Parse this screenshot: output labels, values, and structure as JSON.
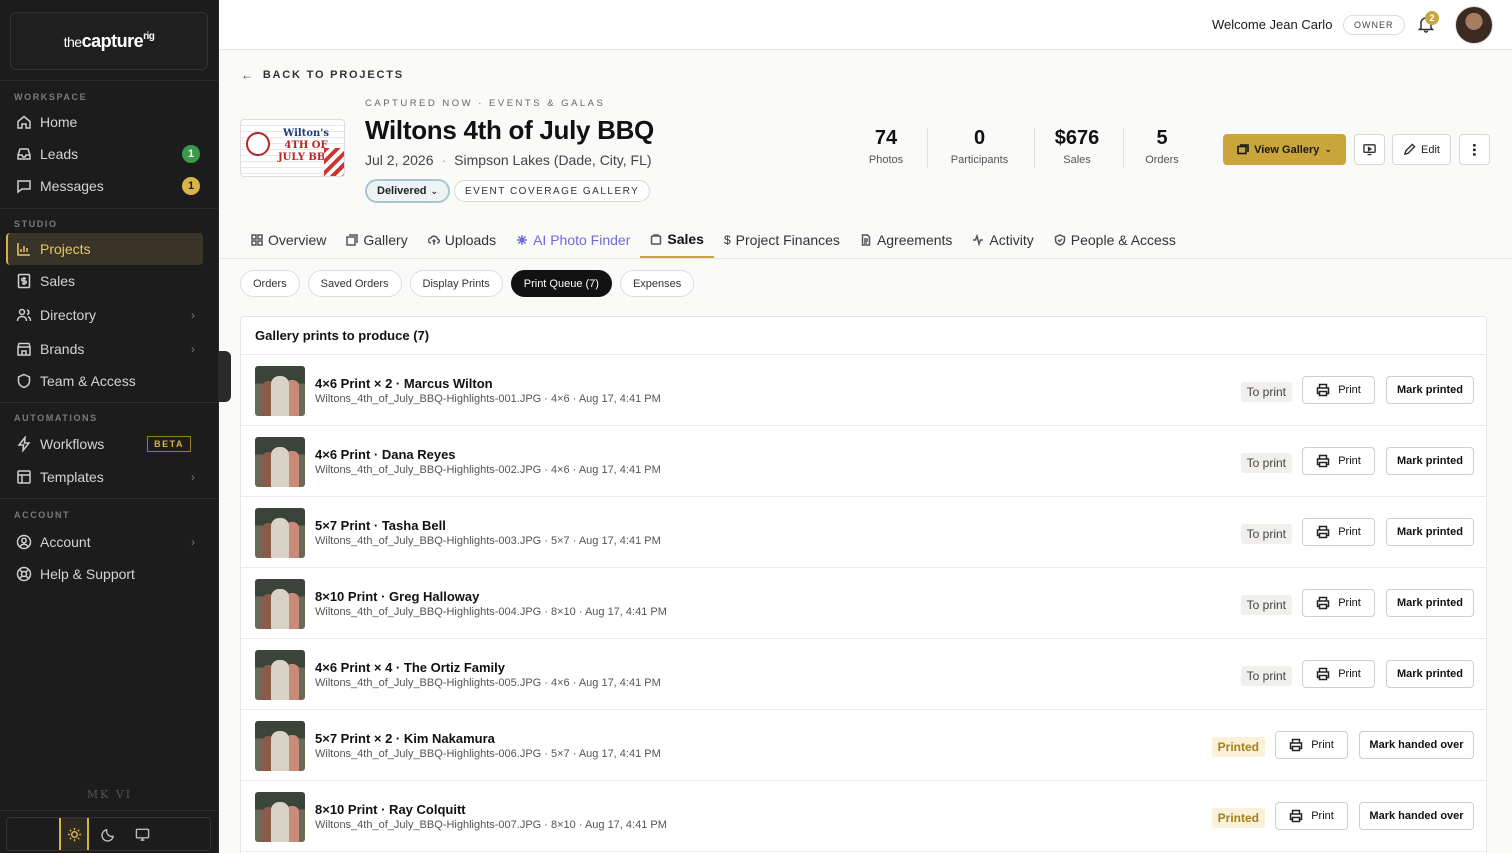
{
  "brand": {
    "name_a": "the",
    "name_b": "capture",
    "name_c": "rig"
  },
  "sidebar": {
    "sections": {
      "workspace": "WORKSPACE",
      "studio": "STUDIO",
      "automations": "AUTOMATIONS",
      "account": "ACCOUNT"
    },
    "items": {
      "home": {
        "label": "Home"
      },
      "leads": {
        "label": "Leads",
        "badge": "1"
      },
      "messages": {
        "label": "Messages",
        "badge": "1"
      },
      "projects": {
        "label": "Projects"
      },
      "sales": {
        "label": "Sales"
      },
      "directory": {
        "label": "Directory"
      },
      "brands": {
        "label": "Brands"
      },
      "team": {
        "label": "Team & Access"
      },
      "workflows": {
        "label": "Workflows",
        "tag": "BETA"
      },
      "templates": {
        "label": "Templates"
      },
      "account": {
        "label": "Account"
      },
      "help": {
        "label": "Help & Support"
      }
    },
    "footer_mark": "MK VI"
  },
  "topbar": {
    "welcome": "Welcome Jean Carlo",
    "role": "OWNER",
    "notifications": "2"
  },
  "back_link": "BACK TO PROJECTS",
  "project": {
    "eyebrow": "CAPTURED NOW  ·  EVENTS & GALAS",
    "title": "Wiltons 4th of July BBQ",
    "date": "Jul 2, 2026",
    "location": "Simpson Lakes (Dade, City, FL)",
    "status": "Delivered",
    "type": "EVENT COVERAGE GALLERY",
    "thumb_text_a": "Wilton's",
    "thumb_text_b": "4TH OF JULY BBQ"
  },
  "stats": {
    "photos": {
      "value": "74",
      "label": "Photos"
    },
    "participants": {
      "value": "0",
      "label": "Participants"
    },
    "sales": {
      "value": "$676",
      "label": "Sales"
    },
    "orders": {
      "value": "5",
      "label": "Orders"
    }
  },
  "actions": {
    "view_gallery": "View Gallery",
    "edit": "Edit"
  },
  "tabs": {
    "overview": "Overview",
    "gallery": "Gallery",
    "uploads": "Uploads",
    "ai": "AI Photo Finder",
    "sales": "Sales",
    "finances": "Project Finances",
    "agreements": "Agreements",
    "activity": "Activity",
    "people": "People & Access"
  },
  "subtabs": {
    "orders": "Orders",
    "saved": "Saved Orders",
    "display": "Display Prints",
    "queue": "Print Queue (7)",
    "expenses": "Expenses"
  },
  "panel": {
    "title": "Gallery prints to produce (7)",
    "print_label": "Print",
    "rows": [
      {
        "title": "4×6 Print × 2 · Marcus Wilton",
        "sub": "Wiltons_4th_of_July_BBQ-Highlights-001.JPG · 4×6 · Aug 17, 4:41 PM",
        "status": "To print",
        "action": "Mark printed"
      },
      {
        "title": "4×6 Print · Dana Reyes",
        "sub": "Wiltons_4th_of_July_BBQ-Highlights-002.JPG · 4×6 · Aug 17, 4:41 PM",
        "status": "To print",
        "action": "Mark printed"
      },
      {
        "title": "5×7 Print · Tasha Bell",
        "sub": "Wiltons_4th_of_July_BBQ-Highlights-003.JPG · 5×7 · Aug 17, 4:41 PM",
        "status": "To print",
        "action": "Mark printed"
      },
      {
        "title": "8×10 Print · Greg Halloway",
        "sub": "Wiltons_4th_of_July_BBQ-Highlights-004.JPG · 8×10 · Aug 17, 4:41 PM",
        "status": "To print",
        "action": "Mark printed"
      },
      {
        "title": "4×6 Print × 4 · The Ortiz Family",
        "sub": "Wiltons_4th_of_July_BBQ-Highlights-005.JPG · 4×6 · Aug 17, 4:41 PM",
        "status": "To print",
        "action": "Mark printed"
      },
      {
        "title": "5×7 Print × 2 · Kim Nakamura",
        "sub": "Wiltons_4th_of_July_BBQ-Highlights-006.JPG · 5×7 · Aug 17, 4:41 PM",
        "status": "Printed",
        "action": "Mark handed over"
      },
      {
        "title": "8×10 Print · Ray Colquitt",
        "sub": "Wiltons_4th_of_July_BBQ-Highlights-007.JPG · 8×10 · Aug 17, 4:41 PM",
        "status": "Printed",
        "action": "Mark handed over"
      }
    ]
  },
  "colors": {
    "accent": "#c9a53c",
    "sidebar_bg": "#1c1c1c",
    "active_text": "#e8c766",
    "ai_purple": "#6f6ad8",
    "leads_badge": "#3a9a4a"
  }
}
